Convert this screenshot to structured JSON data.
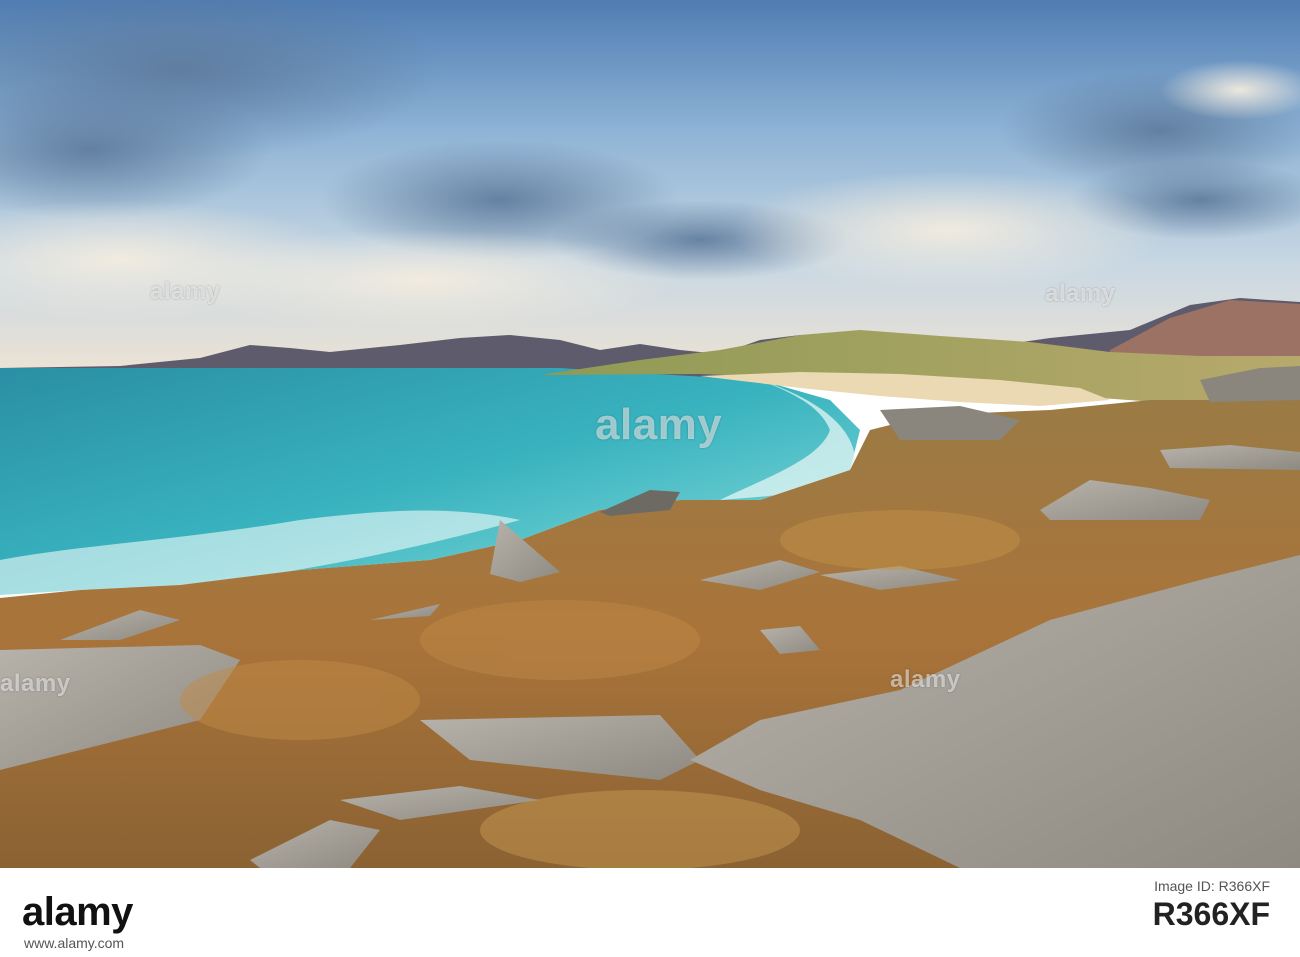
{
  "image": {
    "description_colors": {
      "sky_top": "#5a85b8",
      "sky_mid": "#a9c6dc",
      "sky_horizon": "#e8ddd0",
      "sea_deep": "#1f8c9e",
      "sea_shallow": "#5fd3d2",
      "sand": "#e9d8b0",
      "heather": "#b07a3c",
      "grass": "#9aa25a",
      "rock": "#a9a59c",
      "hills": "#5d5a6a"
    }
  },
  "watermarks": {
    "text": "alamy"
  },
  "footer": {
    "logo": "alamy",
    "id_label": "Image ID: R366XF",
    "id_code": "R366XF",
    "site": "www.alamy.com"
  }
}
